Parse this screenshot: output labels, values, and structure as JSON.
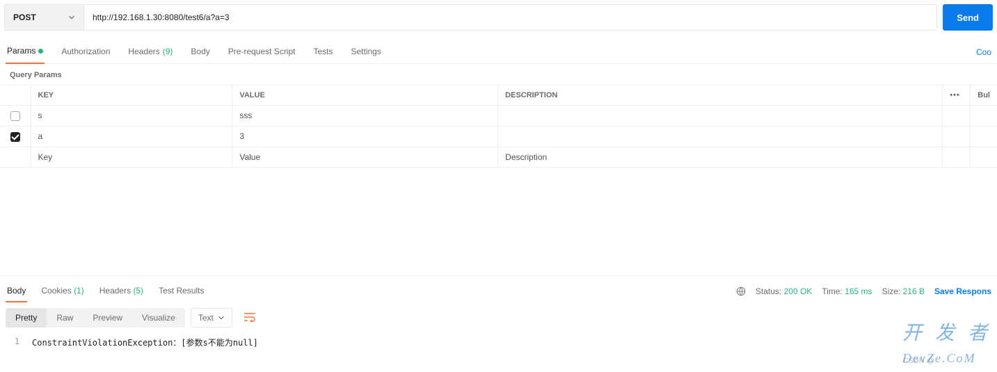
{
  "request": {
    "method": "POST",
    "url": "http://192.168.1.30:8080/test6/a?a=3",
    "send_label": "Send"
  },
  "tabs": {
    "params": "Params",
    "authorization": "Authorization",
    "headers": "Headers",
    "headers_count": "(9)",
    "body": "Body",
    "prerequest": "Pre-request Script",
    "tests": "Tests",
    "settings": "Settings",
    "cookies_link": "Coo"
  },
  "params_section": {
    "title": "Query Params",
    "columns": {
      "key": "KEY",
      "value": "VALUE",
      "description": "DESCRIPTION",
      "bulk": "Bul"
    },
    "rows": [
      {
        "checked": false,
        "key": "s",
        "value": "sss",
        "description": ""
      },
      {
        "checked": true,
        "key": "a",
        "value": "3",
        "description": ""
      }
    ],
    "placeholders": {
      "key": "Key",
      "value": "Value",
      "description": "Description"
    }
  },
  "response": {
    "tabs": {
      "body": "Body",
      "cookies": "Cookies",
      "cookies_count": "(1)",
      "headers": "Headers",
      "headers_count": "(5)",
      "tests": "Test Results"
    },
    "status_label": "Status:",
    "status_value": "200 OK",
    "time_label": "Time:",
    "time_value": "165 ms",
    "size_label": "Size:",
    "size_value": "216 B",
    "save_label": "Save Respons",
    "view_modes": {
      "pretty": "Pretty",
      "raw": "Raw",
      "preview": "Preview",
      "visualize": "Visualize"
    },
    "content_type": "Text",
    "body_lines": [
      {
        "n": "1",
        "text": "ConstraintViolationException：[参数s不能为null]"
      }
    ]
  },
  "watermark": {
    "brand": "开 发 者",
    "sub": "DevZe.CoM",
    "csdn": "CSDN @"
  }
}
